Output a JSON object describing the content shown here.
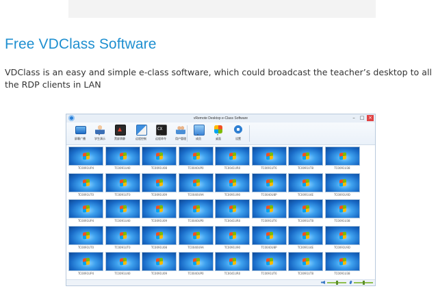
{
  "article": {
    "heading": "Free VDClass Software",
    "description": "VDClass is an easy and simple e-class software, which could broadcast the teacher’s desktop to all the RDP clients in LAN"
  },
  "window": {
    "title": "vRemote Desktop e-Class Software",
    "controls": {
      "minimize": "–",
      "maximize": "□",
      "close": "×"
    },
    "toolbar": [
      {
        "label": "屏幕广播",
        "icon": "monitor-icon",
        "has_menu": false
      },
      {
        "label": "学生演示",
        "icon": "student-icon",
        "has_menu": true
      },
      {
        "label": "黑屏肃静",
        "icon": "blackscreen-icon",
        "has_menu": false
      },
      {
        "label": "远程控制",
        "icon": "remote-control-icon",
        "has_menu": false
      },
      {
        "label": "远程命令",
        "icon": "command-icon",
        "has_menu": true
      },
      {
        "label": "用户管理",
        "icon": "users-icon",
        "has_menu": false
      },
      {
        "label": "成员",
        "icon": "group-icon",
        "has_menu": true
      },
      {
        "label": "桌面",
        "icon": "desktop-icon",
        "has_menu": true
      },
      {
        "label": "设置",
        "icon": "gear-icon",
        "has_menu": false
      }
    ],
    "clients": [
      "TC0091UP4",
      "TC0091U40",
      "TC0091U08",
      "TC0040UP0",
      "TC0041UR0",
      "TC0091UT6",
      "TC0091UT8",
      "TC0091U38",
      "TC0091UT0",
      "TC0091UT0",
      "TC0091U09",
      "TC0040U9A",
      "TC0091U90",
      "TC0040U8P",
      "TC0091U4E",
      "TC0091U9D",
      "TC0091UP4",
      "TC0091U40",
      "TC0091U09",
      "TC0040UP0",
      "TC0041UR0",
      "TC0091UT6",
      "TC0091UT8",
      "TC0091U38",
      "TC0091UT0",
      "TC0091UT0",
      "TC0091U08",
      "TC0040U9A",
      "TC0091U90",
      "TC0040U8P",
      "TC0091U4E",
      "TC0091U9D",
      "TC0091UP4",
      "TC0091U40",
      "TC0091U09",
      "TC0040UP0",
      "TC0041UR0",
      "TC0091UT6",
      "TC0091UT8",
      "TC0091U38"
    ],
    "status": {
      "volume_level": 0.5,
      "mic_level": 0.5
    }
  }
}
